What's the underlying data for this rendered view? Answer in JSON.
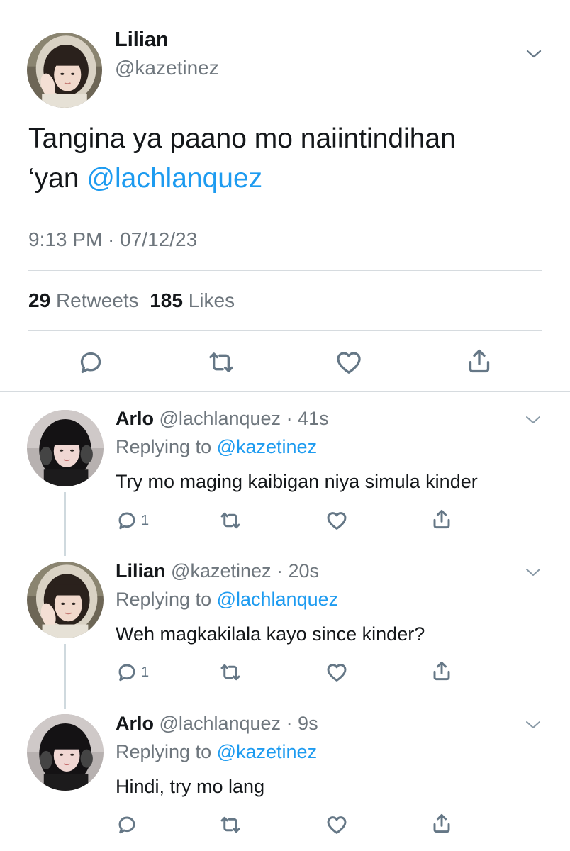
{
  "main_tweet": {
    "name": "Lilian",
    "handle": "@kazetinez",
    "text_before": "Tangina ya paano mo naiintindihan",
    "text_line2": "‘yan ",
    "mention": "@lachlanquez",
    "timestamp": "9:13 PM · 07/12/23",
    "retweets_count": "29",
    "retweets_label": "Retweets",
    "likes_count": "185",
    "likes_label": "Likes"
  },
  "replies": [
    {
      "name": "Arlo",
      "handle": "@lachlanquez",
      "time": "· 41s",
      "replying_prefix": "Replying to ",
      "replying_to": "@kazetinez",
      "text": "Try mo maging kaibigan niya simula kinder",
      "reply_count": "1"
    },
    {
      "name": "Lilian",
      "handle": "@kazetinez",
      "time": "· 20s",
      "replying_prefix": "Replying to ",
      "replying_to": "@lachlanquez",
      "text": "Weh magkakilala kayo since kinder?",
      "reply_count": "1"
    },
    {
      "name": "Arlo",
      "handle": "@lachlanquez",
      "time": "· 9s",
      "replying_prefix": "Replying to ",
      "replying_to": "@kazetinez",
      "text": "Hindi, try mo lang",
      "reply_count": ""
    }
  ],
  "icons": {
    "reply": "reply-icon",
    "retweet": "retweet-icon",
    "like": "heart-icon",
    "share": "share-icon",
    "more": "chevron-down-icon"
  },
  "colors": {
    "accent": "#1d9bf0",
    "secondary_text": "#6e767d",
    "divider": "#d6dbdf"
  }
}
